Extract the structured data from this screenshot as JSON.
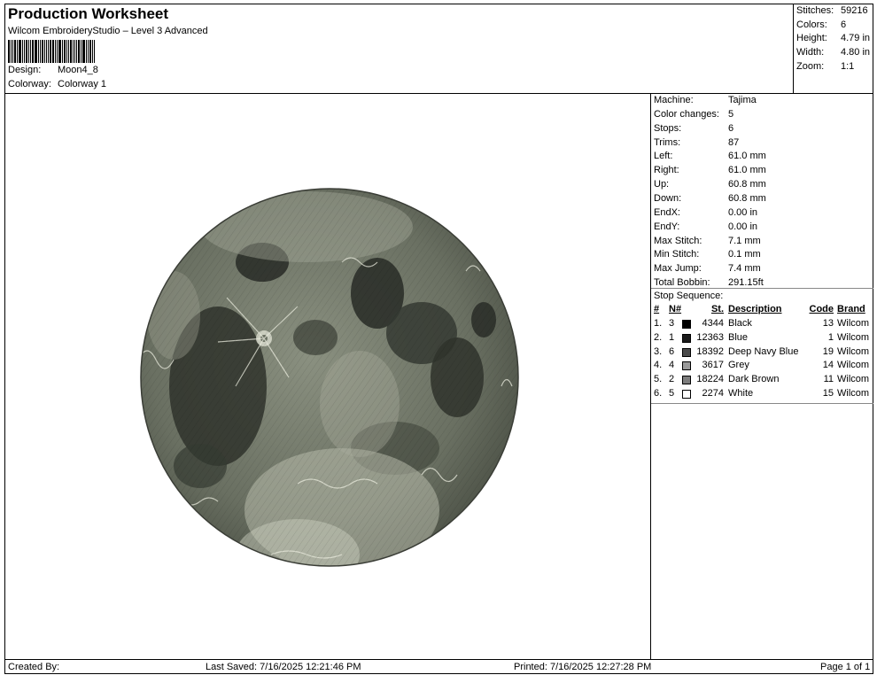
{
  "header": {
    "title": "Production Worksheet",
    "subtitle": "Wilcom EmbroideryStudio – Level 3 Advanced",
    "design_label": "Design:",
    "design_value": "Moon4_8",
    "colorway_label": "Colorway:",
    "colorway_value": "Colorway 1"
  },
  "summary": [
    {
      "label": "Stitches:",
      "value": "59216"
    },
    {
      "label": "Colors:",
      "value": "6"
    },
    {
      "label": "Height:",
      "value": "4.79 in"
    },
    {
      "label": "Width:",
      "value": "4.80 in"
    },
    {
      "label": "Zoom:",
      "value": "1:1"
    }
  ],
  "machine_info": [
    {
      "label": "Machine:",
      "value": "Tajima"
    },
    {
      "label": "Color changes:",
      "value": "5"
    },
    {
      "label": "Stops:",
      "value": "6"
    },
    {
      "label": "Trims:",
      "value": "87"
    },
    {
      "label": "Left:",
      "value": "61.0 mm"
    },
    {
      "label": "Right:",
      "value": "61.0 mm"
    },
    {
      "label": "Up:",
      "value": "60.8 mm"
    },
    {
      "label": "Down:",
      "value": "60.8 mm"
    },
    {
      "label": "EndX:",
      "value": "0.00 in"
    },
    {
      "label": "EndY:",
      "value": "0.00 in"
    },
    {
      "label": "Max Stitch:",
      "value": "7.1 mm"
    },
    {
      "label": "Min Stitch:",
      "value": "0.1 mm"
    },
    {
      "label": "Max Jump:",
      "value": "7.4 mm"
    },
    {
      "label": "Total Bobbin:",
      "value": "291.15ft"
    }
  ],
  "stop_sequence": {
    "title": "Stop Sequence:",
    "headers": {
      "idx": "#",
      "n": "N#",
      "st": "St.",
      "desc": "Description",
      "code": "Code",
      "brand": "Brand"
    },
    "rows": [
      {
        "idx": "1.",
        "n": "3",
        "color": "#000000",
        "st": "4344",
        "desc": "Black",
        "code": "13",
        "brand": "Wilcom"
      },
      {
        "idx": "2.",
        "n": "1",
        "color": "#1a1a1a",
        "st": "12363",
        "desc": "Blue",
        "code": "1",
        "brand": "Wilcom"
      },
      {
        "idx": "3.",
        "n": "6",
        "color": "#4a4a4a",
        "st": "18392",
        "desc": "Deep Navy Blue",
        "code": "19",
        "brand": "Wilcom"
      },
      {
        "idx": "4.",
        "n": "4",
        "color": "#9a9a9a",
        "st": "3617",
        "desc": "Grey",
        "code": "14",
        "brand": "Wilcom"
      },
      {
        "idx": "5.",
        "n": "2",
        "color": "#7d7d7d",
        "st": "18224",
        "desc": "Dark Brown",
        "code": "11",
        "brand": "Wilcom"
      },
      {
        "idx": "6.",
        "n": "5",
        "color": "#ffffff",
        "st": "2274",
        "desc": "White",
        "code": "15",
        "brand": "Wilcom"
      }
    ]
  },
  "footer": {
    "created_by": "Created By:",
    "last_saved": "Last Saved: 7/16/2025 12:21:46 PM",
    "printed": "Printed: 7/16/2025 12:27:28 PM",
    "page": "Page 1 of 1"
  },
  "design_preview": {
    "icon": "moon-embroidery-preview",
    "colors": {
      "base": "#6f7566",
      "light": "#c9cdbd",
      "dark": "#2c302a",
      "thread": "#e8eadc"
    }
  }
}
